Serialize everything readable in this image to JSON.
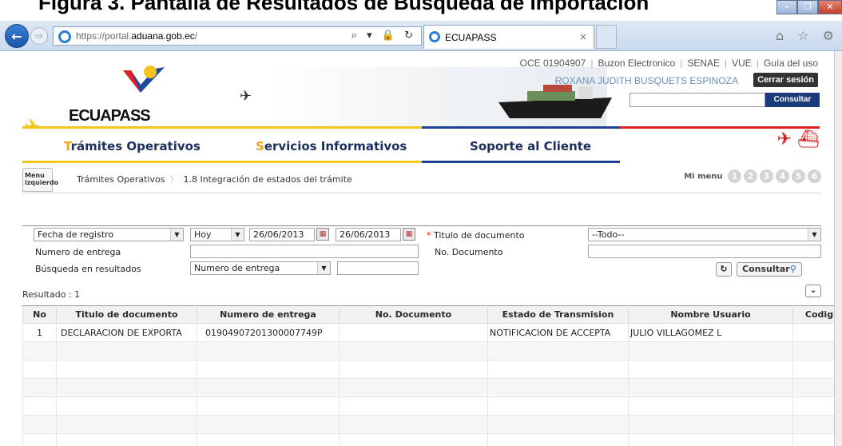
{
  "top_heading": "Figura 3. Pantalla de Resultados de Búsqueda de Importación",
  "browser": {
    "url_prefix": "https://portal.",
    "url_domain": "aduana.gob.ec",
    "url_suffix": "/",
    "addr_controls": "⌕ ▾ 🔒 ↻",
    "tab_title": "ECUAPASS",
    "tab_close": "×",
    "tools": "⌂ ☆ ⚙",
    "win_minimize": "–",
    "win_restore": "❐",
    "win_close": "✕"
  },
  "header": {
    "logo": "ECUAPASS",
    "top_links": [
      "OCE 01904907",
      "Buzon Electronico",
      "SENAE",
      "VUE",
      "Guía del uso"
    ],
    "user_name": "ROXANA JUDITH BUSQUETS ESPINOZA",
    "logout_label": "Cerrar sesión",
    "search_value": "",
    "search_button": "Consultar"
  },
  "nav": {
    "items": [
      {
        "first": "T",
        "rest": "rámites Operativos"
      },
      {
        "first": "S",
        "rest": "ervicios Informativos"
      },
      {
        "first": "S",
        "rest": "oporte al Cliente"
      }
    ]
  },
  "breadcrumb": {
    "menu_left_line1": "Menu",
    "menu_left_line2": "izquierdo",
    "level1": "Trámites Operativos",
    "level2": "1.8 Integración de estados del trámite",
    "mi_menu": "Mi menu",
    "circles": [
      "1",
      "2",
      "3",
      "4",
      "5",
      "6"
    ]
  },
  "form": {
    "date_type": "Fecha de registro",
    "period": "Hoy",
    "date_from": "26/06/2013",
    "date_to": "26/06/2013",
    "title_label": "Titulo de documento",
    "title_value": "--Todo--",
    "entrega_label": "Numero de entrega",
    "entrega_value": "",
    "doc_label": "No. Documento",
    "doc_value": "",
    "search_in_label": "Búsqueda en resultados",
    "search_in_field": "Numero de entrega",
    "search_in_value": "",
    "consultar_label": "Consultar"
  },
  "results": {
    "count_label": "Resultado : 1",
    "columns": [
      "No",
      "Titulo de documento",
      "Numero de entrega",
      "No. Documento",
      "Estado de Transmision",
      "Nombre Usuario",
      "Codig"
    ],
    "rows": [
      [
        "1",
        "DECLARACION DE EXPORTA",
        "01904907201300007749P",
        "",
        "NOTIFICACION DE ACCEPTA",
        "JULIO VILLAGOMEZ L",
        ""
      ]
    ]
  },
  "colors": {
    "yellow": "#f4c51c",
    "blue": "#1f3f93",
    "red": "#e02020",
    "nav_text": "#1d2d5c"
  }
}
